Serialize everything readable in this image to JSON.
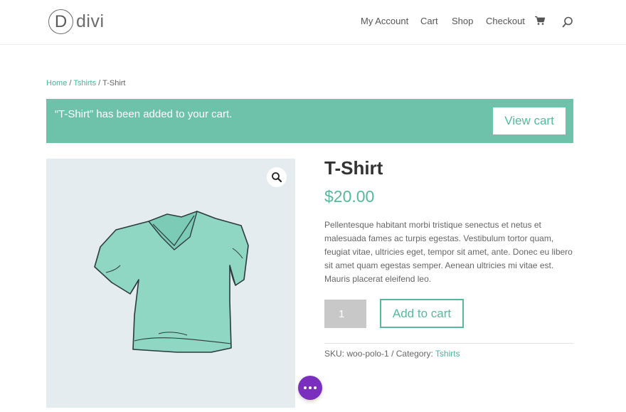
{
  "header": {
    "logo_letter": "D",
    "logo_text": "divi",
    "nav": [
      "My Account",
      "Cart",
      "Shop",
      "Checkout"
    ],
    "icons": [
      "cart-icon",
      "search-icon"
    ]
  },
  "breadcrumb": {
    "home": "Home",
    "category": "Tshirts",
    "current": "T-Shirt",
    "separator": " / "
  },
  "notice": {
    "message": "“T-Shirt” has been added to your cart.",
    "button": "View cart"
  },
  "product": {
    "title": "T-Shirt",
    "price": "$20.00",
    "description": "Pellentesque habitant morbi tristique senectus et netus et malesuada fames ac turpis egestas. Vestibulum tortor quam, feugiat vitae, ultricies eget, tempor sit amet, ante. Donec eu libero sit amet quam egestas semper. Aenean ultricies mi vitae est. Mauris placerat eleifend leo.",
    "quantity": "1",
    "add_to_cart": "Add to cart",
    "sku_label": "SKU:",
    "sku": "woo-polo-1",
    "category_label": "Category:",
    "category": "Tshirts",
    "meta_separator": " / "
  },
  "colors": {
    "accent": "#56b99d",
    "notice_bg": "#6dc2a9",
    "image_bg": "#e4ecef",
    "fab": "#7b2fbe"
  }
}
